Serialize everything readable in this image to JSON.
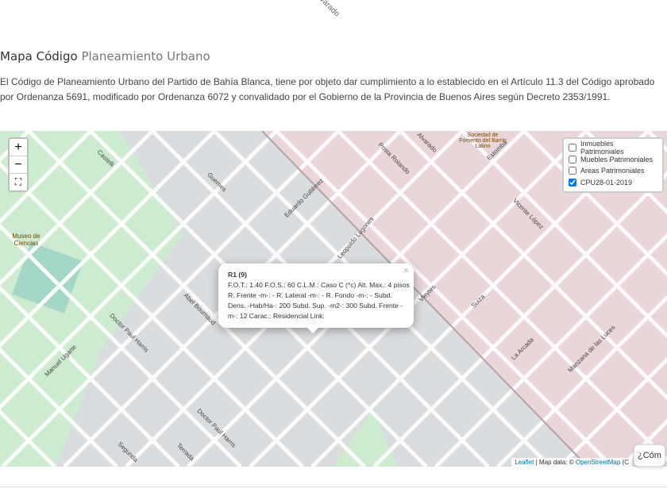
{
  "header": {
    "title_main": "Mapa Código",
    "title_sub": "Planeamiento Urbano",
    "top_street": "Alvarado"
  },
  "intro": {
    "line1": "El Código de Planeamiento Urbano del Partido de Bahía Blanca, tiene por objeto dar cumplimiento a lo establecido en el Artículo 11.3 del Código aprobado por Ordenanza",
    "line2": "5691, modificado por Ordenanza 6072 y convalidado por el Gobierno de la Provincia de Buenos Aires según Decreto 2353/1991."
  },
  "map": {
    "zoom_in": "+",
    "zoom_out": "−",
    "fullscreen": "⛶",
    "layers": [
      {
        "label": "Inmuebles Patrimoniales",
        "checked": false
      },
      {
        "label": "Muebles Patrimoniales",
        "checked": false
      },
      {
        "label": "Areas Patrimoniales",
        "checked": false
      },
      {
        "label": "CPU28-01-2019",
        "checked": true
      }
    ],
    "popup": {
      "title": "R1 (9)",
      "body": "F.O.T.: 1.40 F.O.S.: 60 C.L.M.: Caso C (*c) Alt. Max.: 4 pisos R. Frente -m-: - R. Lateral -m-: - R. Fondo -m-: - Subd. Dens. -Hab/Ha-: 200 Subd. Sup. -m2-: 300 Subd. Frente -m-: 12 Carac.: Residencial Link:",
      "close": "×"
    },
    "streets": [
      "Castelli",
      "Guemes",
      "Eduardo Gutiérrez",
      "Posta Rolando",
      "Leopoldo Lugones",
      "Alvarado",
      "Abel Bournaud",
      "Doctor Paul Harris",
      "Manuel Ugarte",
      "Vieytes",
      "Suiza",
      "Estomba",
      "Vicente López",
      "La Arcada",
      "Manzana de las Luces",
      "Doctor Paul Harris",
      "Terrada",
      "Segunda",
      "Museo de Ciencias",
      "Sociedad de Fomento del Barrio Latino"
    ],
    "attribution": {
      "leaflet": "Leaflet",
      "sep": " | Map data: © ",
      "osm": "OpenStreetMap",
      "tail": " (C"
    },
    "help": "¿Cóm"
  }
}
